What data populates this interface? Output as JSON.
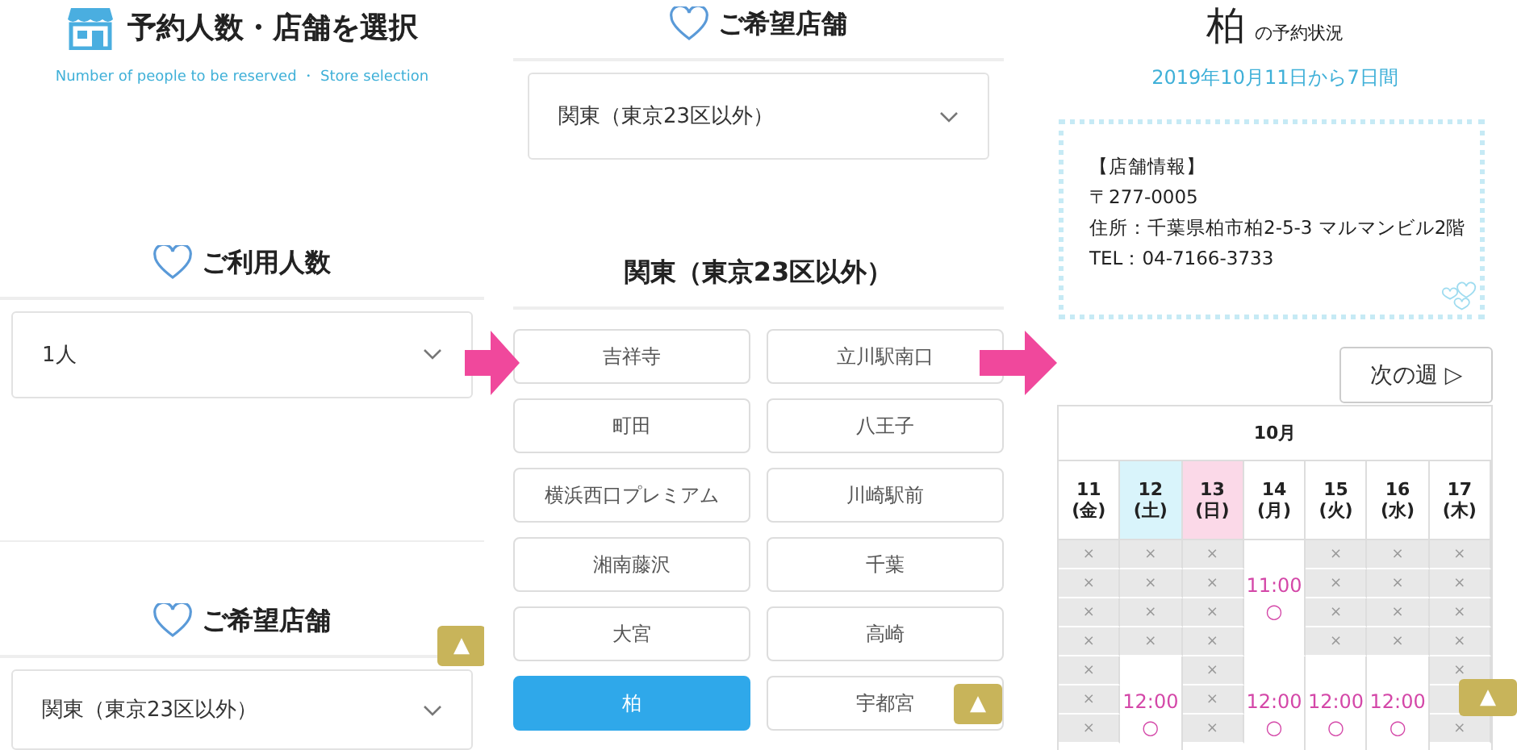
{
  "people_store_screen": {
    "title": "予約人数・店舗を選択",
    "subtitle": "Number of people to be reserved ・ Store selection",
    "people_section": {
      "heading": "ご利用人数",
      "select": {
        "value": "1人"
      }
    },
    "store_section": {
      "heading": "ご希望店舗",
      "select": {
        "value": "関東（東京23区以外）"
      }
    },
    "page_top_button": "▲"
  },
  "store_select_screen": {
    "heading": "ご希望店舗",
    "region_select": {
      "value": "関東（東京23区以外）"
    },
    "region_heading": "関東（東京23区以外）",
    "stores": [
      {
        "label": "吉祥寺",
        "selected": false
      },
      {
        "label": "立川駅南口",
        "selected": false
      },
      {
        "label": "町田",
        "selected": false
      },
      {
        "label": "八王子",
        "selected": false
      },
      {
        "label": "横浜西口プレミアム",
        "selected": false
      },
      {
        "label": "川崎駅前",
        "selected": false
      },
      {
        "label": "湘南藤沢",
        "selected": false
      },
      {
        "label": "千葉",
        "selected": false
      },
      {
        "label": "大宮",
        "selected": false
      },
      {
        "label": "高崎",
        "selected": false
      },
      {
        "label": "柏",
        "selected": true
      },
      {
        "label": "宇都宮",
        "selected": false
      }
    ],
    "page_top_button": "▲"
  },
  "reservation_screen": {
    "store_name": "柏",
    "title_suffix": "の予約状況",
    "period": "2019年10月11日から7日間",
    "store_info": [
      "【店舗情報】",
      "〒277-0005",
      "住所：千葉県柏市柏2-5-3 マルマンビル2階",
      "TEL：04-7166-3733"
    ],
    "next_week_button": "次の週 ▷",
    "calendar": {
      "month": "10月",
      "days": [
        {
          "date": "11",
          "weekday": "(金)",
          "kind": "weekday",
          "slots": [
            {
              "kind": "closed",
              "text": "×"
            },
            {
              "kind": "closed",
              "text": "×"
            },
            {
              "kind": "closed",
              "text": "×"
            },
            {
              "kind": "closed",
              "text": "×"
            },
            {
              "kind": "closed",
              "text": "×"
            },
            {
              "kind": "closed",
              "text": "×"
            },
            {
              "kind": "closed",
              "text": "×"
            }
          ]
        },
        {
          "date": "12",
          "weekday": "(土)",
          "kind": "saturday",
          "slots": [
            {
              "kind": "closed",
              "text": "×"
            },
            {
              "kind": "closed",
              "text": "×"
            },
            {
              "kind": "closed",
              "text": "×"
            },
            {
              "kind": "closed",
              "text": "×"
            },
            {
              "kind": "open",
              "time": "12:00",
              "text": "○"
            }
          ]
        },
        {
          "date": "13",
          "weekday": "(日)",
          "kind": "sunday",
          "slots": [
            {
              "kind": "closed",
              "text": "×"
            },
            {
              "kind": "closed",
              "text": "×"
            },
            {
              "kind": "closed",
              "text": "×"
            },
            {
              "kind": "closed",
              "text": "×"
            },
            {
              "kind": "closed",
              "text": "×"
            },
            {
              "kind": "closed",
              "text": "×"
            },
            {
              "kind": "closed",
              "text": "×"
            }
          ]
        },
        {
          "date": "14",
          "weekday": "(月)",
          "kind": "weekday",
          "slots": [
            {
              "kind": "open",
              "time": "11:00",
              "text": "○"
            },
            {
              "kind": "open",
              "time": "12:00",
              "text": "○"
            }
          ]
        },
        {
          "date": "15",
          "weekday": "(火)",
          "kind": "weekday",
          "slots": [
            {
              "kind": "closed",
              "text": "×"
            },
            {
              "kind": "closed",
              "text": "×"
            },
            {
              "kind": "closed",
              "text": "×"
            },
            {
              "kind": "closed",
              "text": "×"
            },
            {
              "kind": "open",
              "time": "12:00",
              "text": "○"
            }
          ]
        },
        {
          "date": "16",
          "weekday": "(水)",
          "kind": "weekday",
          "slots": [
            {
              "kind": "closed",
              "text": "×"
            },
            {
              "kind": "closed",
              "text": "×"
            },
            {
              "kind": "closed",
              "text": "×"
            },
            {
              "kind": "closed",
              "text": "×"
            },
            {
              "kind": "open",
              "time": "12:00",
              "text": "○"
            }
          ]
        },
        {
          "date": "17",
          "weekday": "(木)",
          "kind": "weekday",
          "slots": [
            {
              "kind": "closed",
              "text": "×"
            },
            {
              "kind": "closed",
              "text": "×"
            },
            {
              "kind": "closed",
              "text": "×"
            },
            {
              "kind": "closed",
              "text": "×"
            },
            {
              "kind": "closed",
              "text": "×"
            },
            {
              "kind": "covered"
            },
            {
              "kind": "closed",
              "text": "×"
            }
          ]
        }
      ]
    },
    "page_top_button": "▲"
  }
}
